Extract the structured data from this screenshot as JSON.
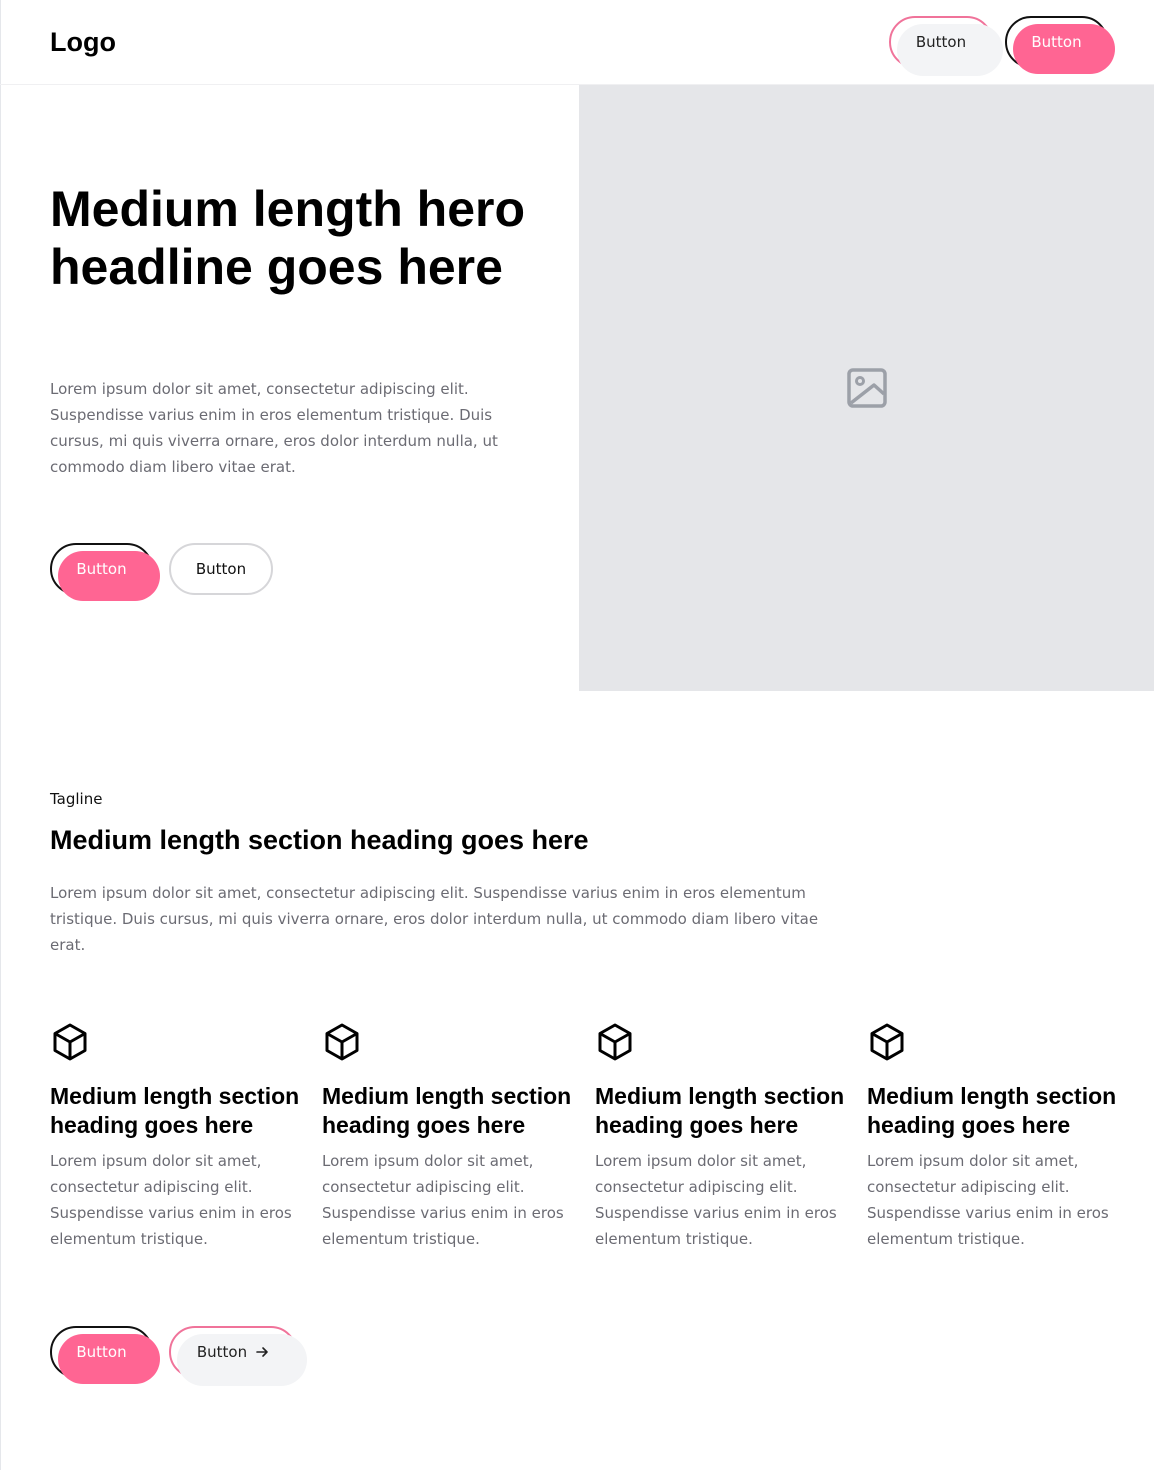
{
  "nav": {
    "logo": "Logo",
    "button_secondary": "Button",
    "button_primary": "Button"
  },
  "hero": {
    "headline": "Medium length hero headline goes here",
    "text": "Lorem ipsum dolor sit amet, consectetur adipiscing elit. Suspendisse varius enim in eros elementum tristique. Duis cursus, mi quis viverra ornare, eros dolor interdum nulla, ut commodo diam libero vitae erat.",
    "button_primary": "Button",
    "button_secondary": "Button",
    "image_icon": "image-placeholder-icon"
  },
  "section": {
    "tagline": "Tagline",
    "heading": "Medium length section heading goes here",
    "text": "Lorem ipsum dolor sit amet, consectetur adipiscing elit. Suspendisse varius enim in eros elementum tristique. Duis cursus, mi quis viverra ornare, eros dolor interdum nulla, ut commodo diam libero vitae erat.",
    "features": [
      {
        "icon": "cube-icon",
        "heading": "Medium length section heading goes here",
        "text": "Lorem ipsum dolor sit amet, consectetur adipiscing elit. Suspendisse varius enim in eros elementum tristique."
      },
      {
        "icon": "cube-icon",
        "heading": "Medium length section heading goes here",
        "text": "Lorem ipsum dolor sit amet, consectetur adipiscing elit. Suspendisse varius enim in eros elementum tristique."
      },
      {
        "icon": "cube-icon",
        "heading": "Medium length section heading goes here",
        "text": "Lorem ipsum dolor sit amet, consectetur adipiscing elit. Suspendisse varius enim in eros elementum tristique."
      },
      {
        "icon": "cube-icon",
        "heading": "Medium length section heading goes here",
        "text": "Lorem ipsum dolor sit amet, consectetur adipiscing elit. Suspendisse varius enim in eros elementum tristique."
      }
    ],
    "button_primary": "Button",
    "button_secondary": "Button",
    "button_secondary_icon": "arrow-right-icon"
  },
  "colors": {
    "accent": "#ff6593",
    "accent_border": "#f0739a",
    "image_bg": "#e5e6e9",
    "body_text": "#6b6b73"
  }
}
